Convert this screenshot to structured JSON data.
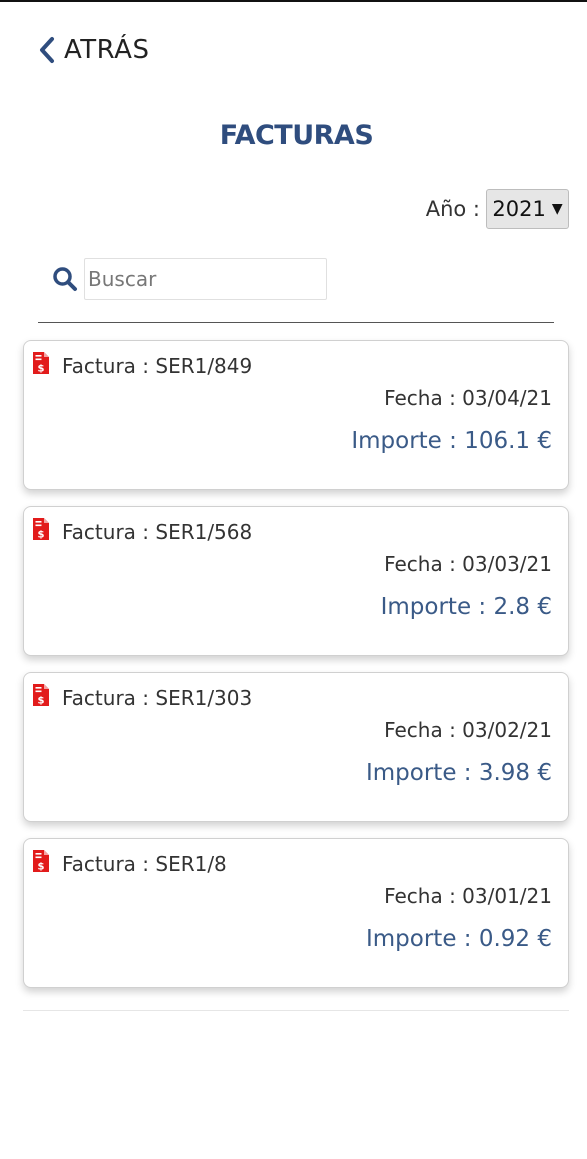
{
  "header": {
    "back_label": "ATRÁS",
    "title": "FACTURAS"
  },
  "filter": {
    "year_label": "Año :",
    "year_value": "2021"
  },
  "search": {
    "placeholder": "Buscar",
    "value": ""
  },
  "invoices": [
    {
      "factura": "Factura : SER1/849",
      "fecha": "Fecha : 03/04/21",
      "importe": "Importe : 106.1 €"
    },
    {
      "factura": "Factura : SER1/568",
      "fecha": "Fecha : 03/03/21",
      "importe": "Importe : 2.8 €"
    },
    {
      "factura": "Factura : SER1/303",
      "fecha": "Fecha : 03/02/21",
      "importe": "Importe : 3.98 €"
    },
    {
      "factura": "Factura : SER1/8",
      "fecha": "Fecha : 03/01/21",
      "importe": "Importe : 0.92 €"
    }
  ],
  "icons": {
    "back": "chevron-left-icon",
    "search": "search-icon",
    "invoice": "invoice-document-icon"
  },
  "colors": {
    "accent": "#2f4d7e",
    "amount": "#3a5a87",
    "invoice_icon": "#e21b1b"
  }
}
